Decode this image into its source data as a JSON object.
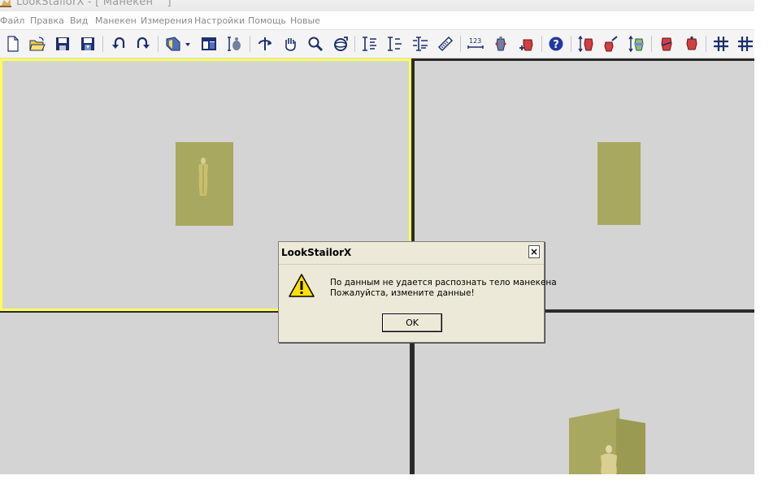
{
  "window": {
    "title": "LookStailorX - [ Манекен    ]"
  },
  "menu": {
    "items": [
      "Файл",
      "Правка",
      "Вид",
      "Манекен",
      "Измерения",
      "Настройки",
      "Помощь",
      "Новые"
    ]
  },
  "toolbar": {
    "buttons": [
      {
        "icon": "new-file-icon"
      },
      {
        "icon": "open-folder-icon"
      },
      {
        "icon": "save-icon"
      },
      {
        "icon": "save-as-icon"
      },
      {
        "icon": "undo-icon"
      },
      {
        "icon": "redo-icon"
      },
      {
        "icon": "view-mode-icon"
      },
      {
        "icon": "dropdown-arrow-icon"
      },
      {
        "icon": "layout-icon"
      },
      {
        "icon": "fit-model-icon"
      },
      {
        "icon": "rotate-icon"
      },
      {
        "icon": "pan-hand-icon"
      },
      {
        "icon": "zoom-icon"
      },
      {
        "icon": "orbit-icon"
      },
      {
        "icon": "measure-height-icon"
      },
      {
        "icon": "measure-side-icon"
      },
      {
        "icon": "measure-multi-icon"
      },
      {
        "icon": "ruler-icon"
      },
      {
        "icon": "numbering-icon"
      },
      {
        "icon": "mannequin-points-icon"
      },
      {
        "icon": "mannequin-add-icon"
      },
      {
        "icon": "help-icon"
      },
      {
        "icon": "mannequin-height-icon"
      },
      {
        "icon": "mannequin-edit-icon"
      },
      {
        "icon": "mannequin-scale-icon"
      },
      {
        "icon": "mannequin-front-icon"
      },
      {
        "icon": "mannequin-back-icon"
      },
      {
        "icon": "grid-icon"
      },
      {
        "icon": "grid-fine-icon"
      }
    ]
  },
  "dialog": {
    "title": "LookStailorX",
    "close": "×",
    "message_line1": "По данным не удается распознать тело манекена",
    "message_line2": "Пожалуйста, измените данные!",
    "ok": "OK"
  },
  "colors": {
    "viewport_bg": "#d4d4d4",
    "active_border": "#ffff55",
    "sheet": "#a8a860",
    "mannequin": "#c8c070",
    "dialog_bg": "#ece9d8"
  }
}
